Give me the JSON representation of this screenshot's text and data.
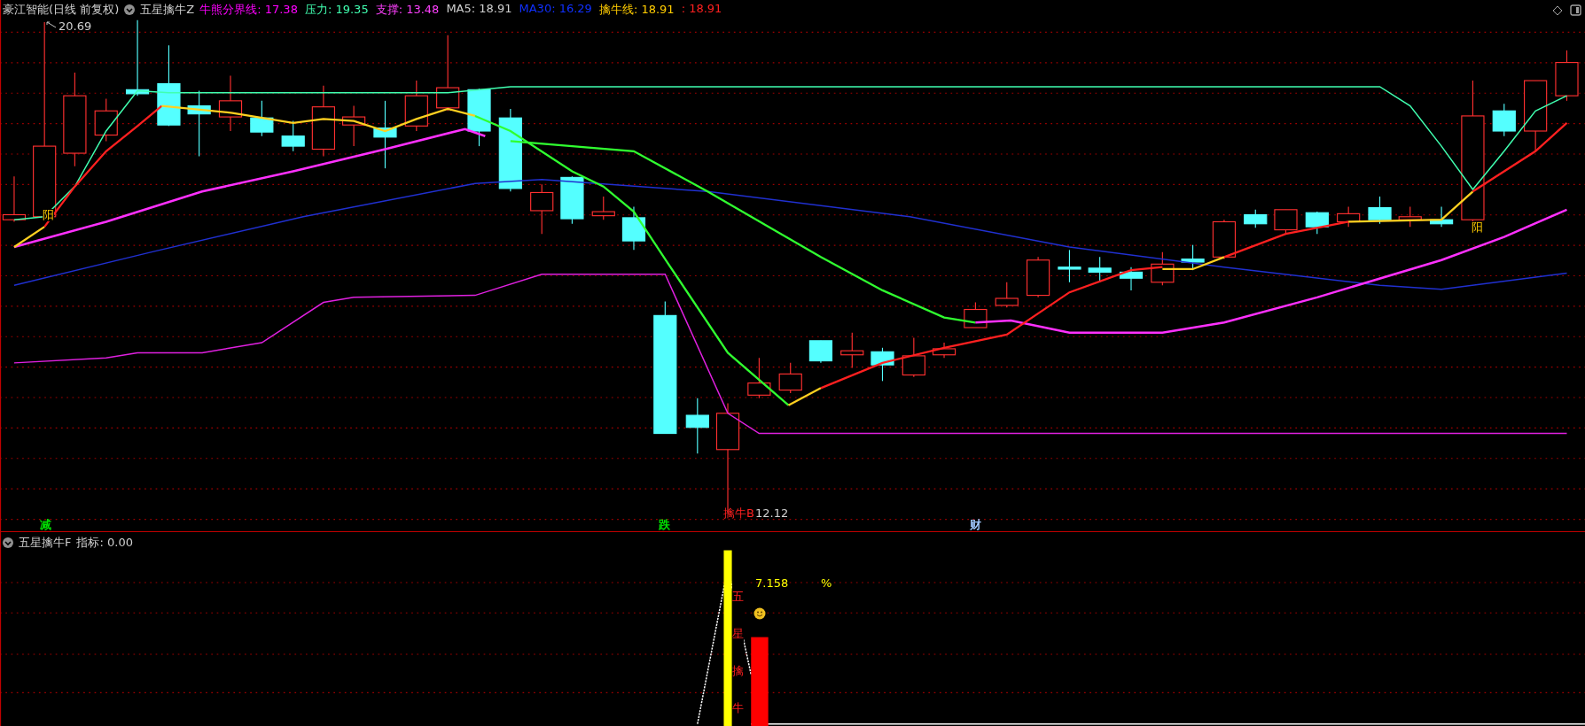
{
  "main_panel": {
    "stock_title": "豪江智能(日线 前复权)",
    "indicator_name": "五星擒牛Z",
    "legend": [
      {
        "text": "牛熊分界线: 17.38",
        "color": "#ff00ff"
      },
      {
        "text": "压力: 19.35",
        "color": "#40ffb0"
      },
      {
        "text": "支撑: 13.48",
        "color": "#ff40ff"
      },
      {
        "text": "MA5: 18.91",
        "color": "#d0d0d0"
      },
      {
        "text": "MA30: 16.29",
        "color": "#1030ff"
      },
      {
        "text": "擒牛线: 18.91",
        "color": "#ffcc00"
      },
      {
        "text": ": 18.91",
        "color": "#ff2020"
      }
    ],
    "high_label": "20.69",
    "low_label": "12.12",
    "buy_label": "擒牛B",
    "signal_labels": [
      "阳",
      "阳"
    ],
    "bottom_markers": [
      {
        "text": "减",
        "color": "#00e000"
      },
      {
        "text": "跌",
        "color": "#00e000"
      },
      {
        "text": "财",
        "color": "#a0c8ff"
      }
    ]
  },
  "indicator_panel": {
    "indicator_name": "五星擒牛F",
    "value_text": "指标: 0.00",
    "percent_value": "7.158",
    "percent_sign": "%",
    "vertical_label": "五星擒牛"
  }
}
